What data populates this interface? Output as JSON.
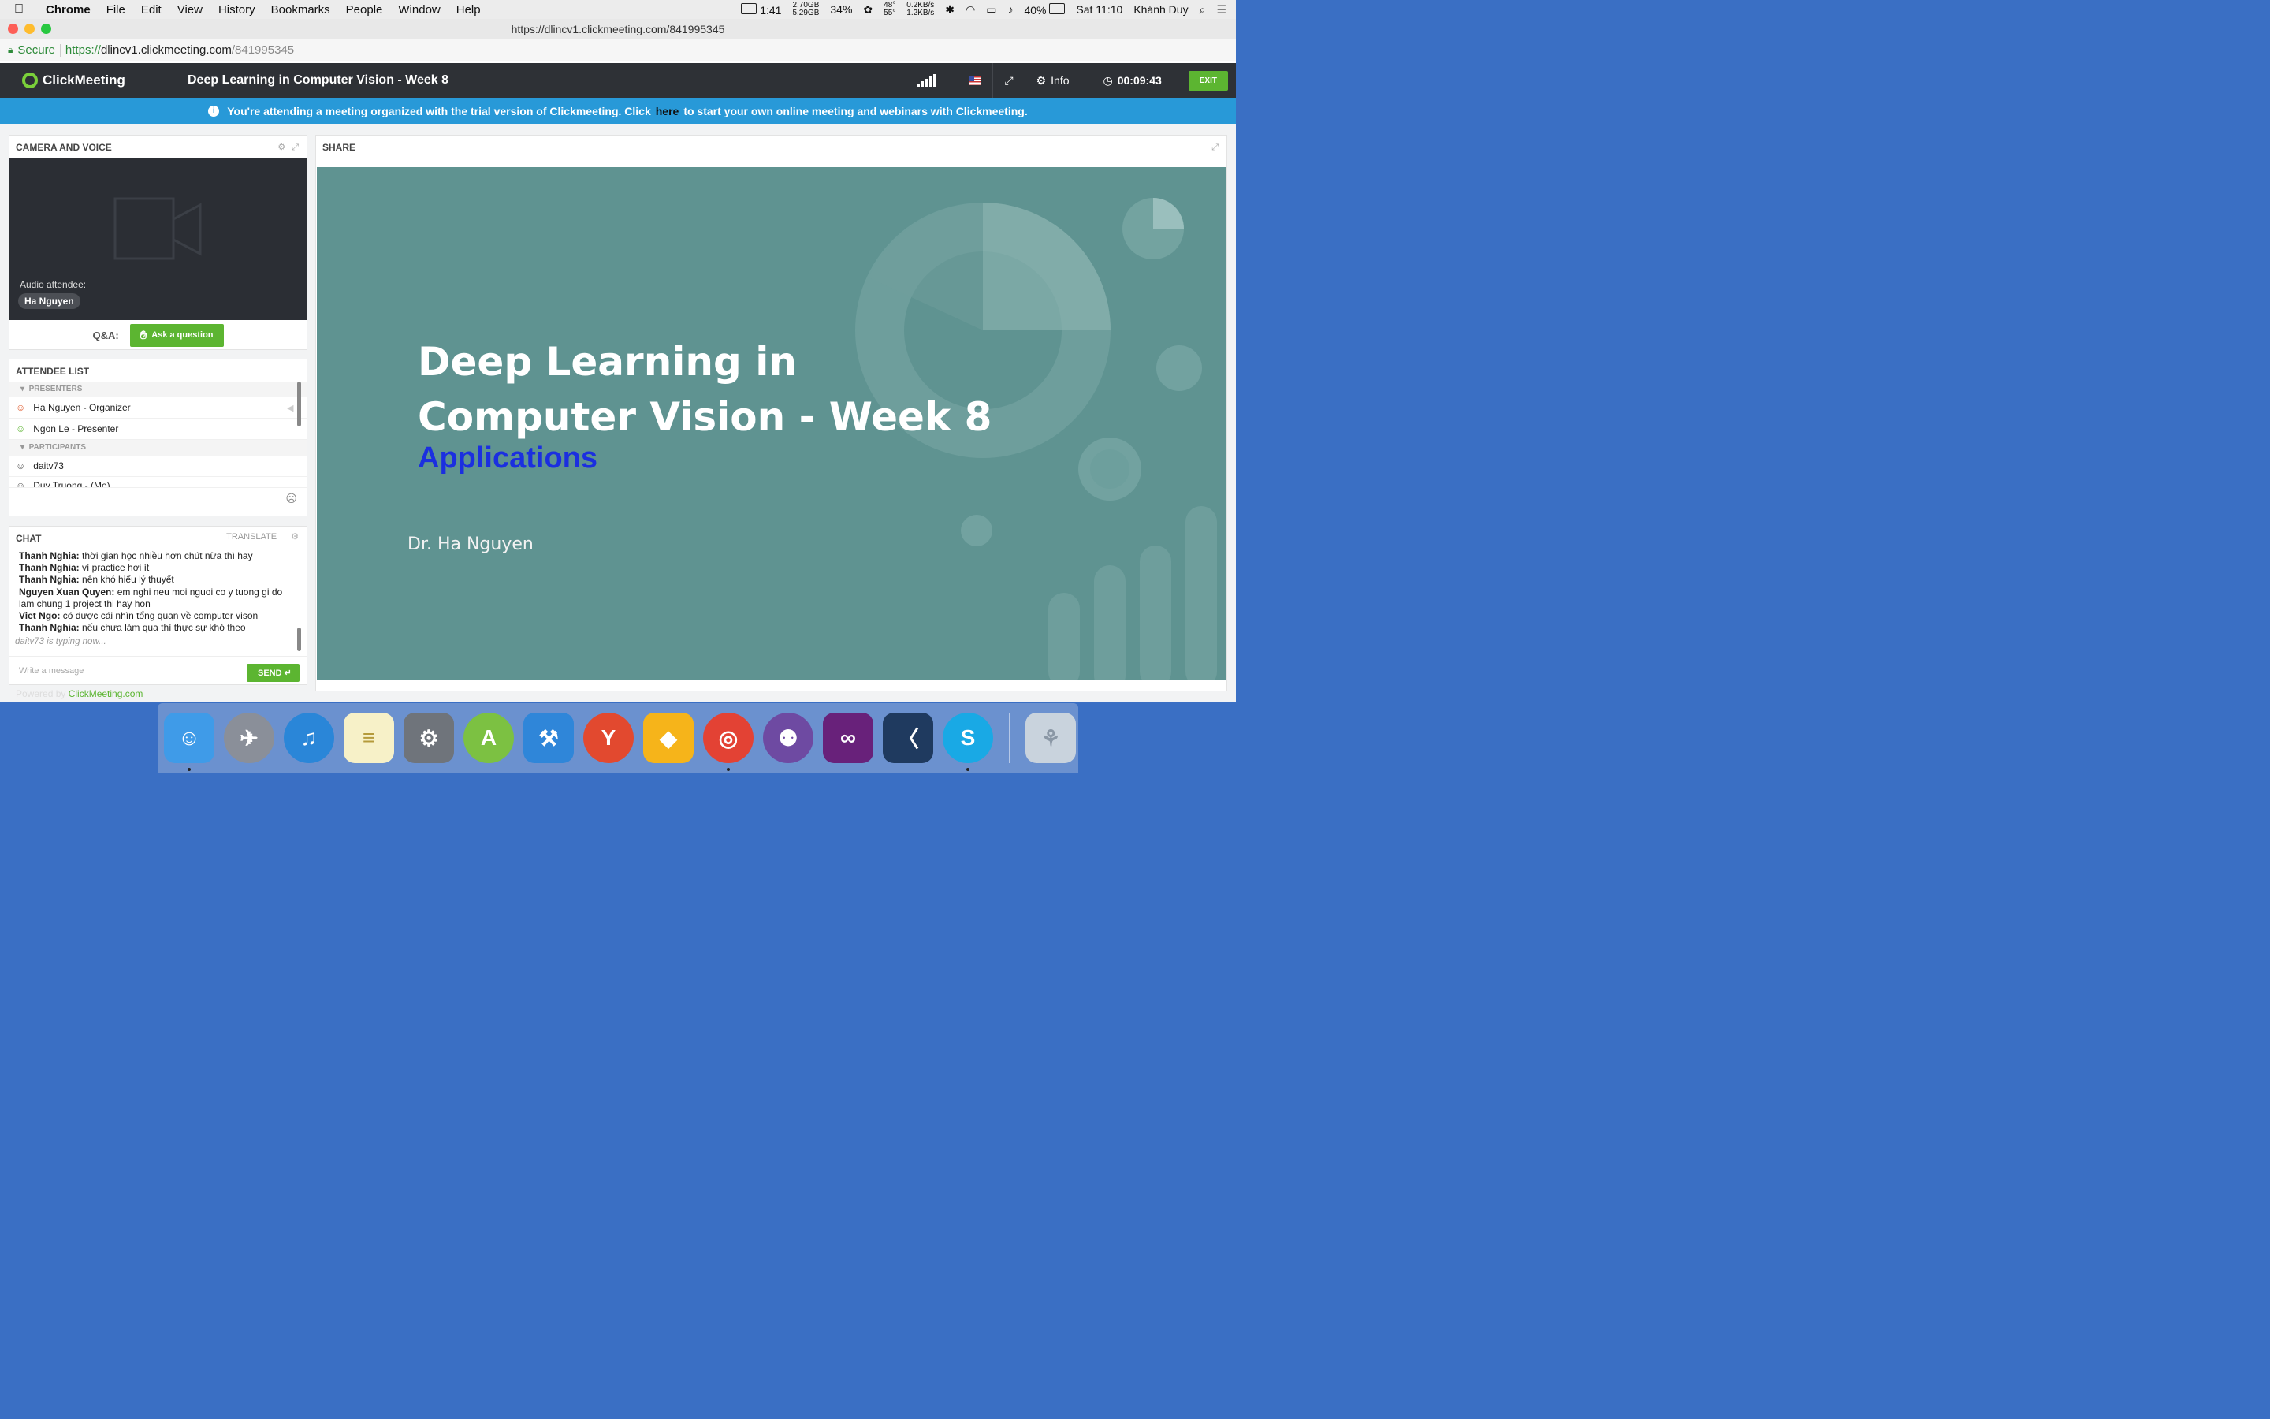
{
  "menubar": {
    "app": "Chrome",
    "items": [
      "File",
      "Edit",
      "View",
      "History",
      "Bookmarks",
      "People",
      "Window",
      "Help"
    ],
    "battery_time": "1:41",
    "mem_top": "2.70GB",
    "mem_bottom": "5.29GB",
    "cpu": "34%",
    "temp_top": "48°",
    "temp_bottom": "55°",
    "net_top": "0.2KB/s",
    "net_bottom": "1.2KB/s",
    "battery": "40%",
    "clock": "Sat 11:10",
    "user": "Khánh Duy"
  },
  "browser": {
    "window_title": "https://dlincv1.clickmeeting.com/841995345",
    "secure_label": "Secure",
    "url_scheme": "https://",
    "url_host": "dlincv1.clickmeeting.com",
    "url_path": "/841995345"
  },
  "header": {
    "logo": "ClickMeeting",
    "meeting_title": "Deep Learning in Computer Vision - Week 8",
    "info_label": "Info",
    "timer": "00:09:43",
    "exit_label": "EXIT"
  },
  "banner": {
    "before": "You're attending a meeting organized with the trial version of Clickmeeting. Click",
    "link": "here",
    "after": "to start your own online meeting and webinars with Clickmeeting."
  },
  "camera": {
    "title": "CAMERA AND VOICE",
    "audio_label": "Audio attendee:",
    "audio_name": "Ha Nguyen",
    "qa_label": "Q&A:",
    "ask_button": "Ask a question"
  },
  "attendees": {
    "title": "ATTENDEE LIST",
    "presenters_label": "PRESENTERS",
    "participants_label": "PARTICIPANTS",
    "presenters": [
      "Ha Nguyen - Organizer",
      "Ngon Le - Presenter"
    ],
    "participants": [
      "daitv73",
      "Duy Truong - (Me)"
    ]
  },
  "chat": {
    "title": "CHAT",
    "translate": "Translate",
    "messages": [
      {
        "author": "Thanh Nghia:",
        "text": "thời gian học nhiều hơn chút nữa thì hay"
      },
      {
        "author": "Thanh Nghia:",
        "text": "vì practice hơi ít"
      },
      {
        "author": "Thanh Nghia:",
        "text": "nên khó hiểu lý thuyết"
      },
      {
        "author": "Nguyen Xuan Quyen:",
        "text": "em nghi neu moi nguoi co y tuong gi do lam chung 1 project thi hay hon"
      },
      {
        "author": "Viet Ngo:",
        "text": "có được cái nhìn tổng quan về computer vison"
      },
      {
        "author": "Thanh Nghia:",
        "text": "nếu chưa làm qua thì thực sự khó theo"
      }
    ],
    "typing": "daitv73 is typing now...",
    "placeholder": "Write a message",
    "send": "SEND"
  },
  "share": {
    "title": "SHARE",
    "slide_title_line1": "Deep Learning in",
    "slide_title_line2": "Computer Vision - Week 8",
    "slide_subtitle": "Applications",
    "slide_author": "Dr. Ha Nguyen"
  },
  "footer": {
    "powered_prefix": "Powered by",
    "powered_brand": "ClickMeeting.com"
  },
  "dock": {
    "apps": [
      "Finder",
      "Launchpad",
      "iTunes",
      "Notes",
      "System Preferences",
      "Android Studio",
      "Xcode",
      "Yummy FTP",
      "Sketch",
      "Chrome",
      "GitHub Desktop",
      "Visual Studio",
      "Visual Studio Code",
      "Skype",
      "Trash"
    ]
  },
  "colors": {
    "accent_green": "#5cb531",
    "banner_blue": "#2899d8",
    "slide_bg": "#5f9391",
    "slide_subtitle": "#1b2fe0"
  }
}
